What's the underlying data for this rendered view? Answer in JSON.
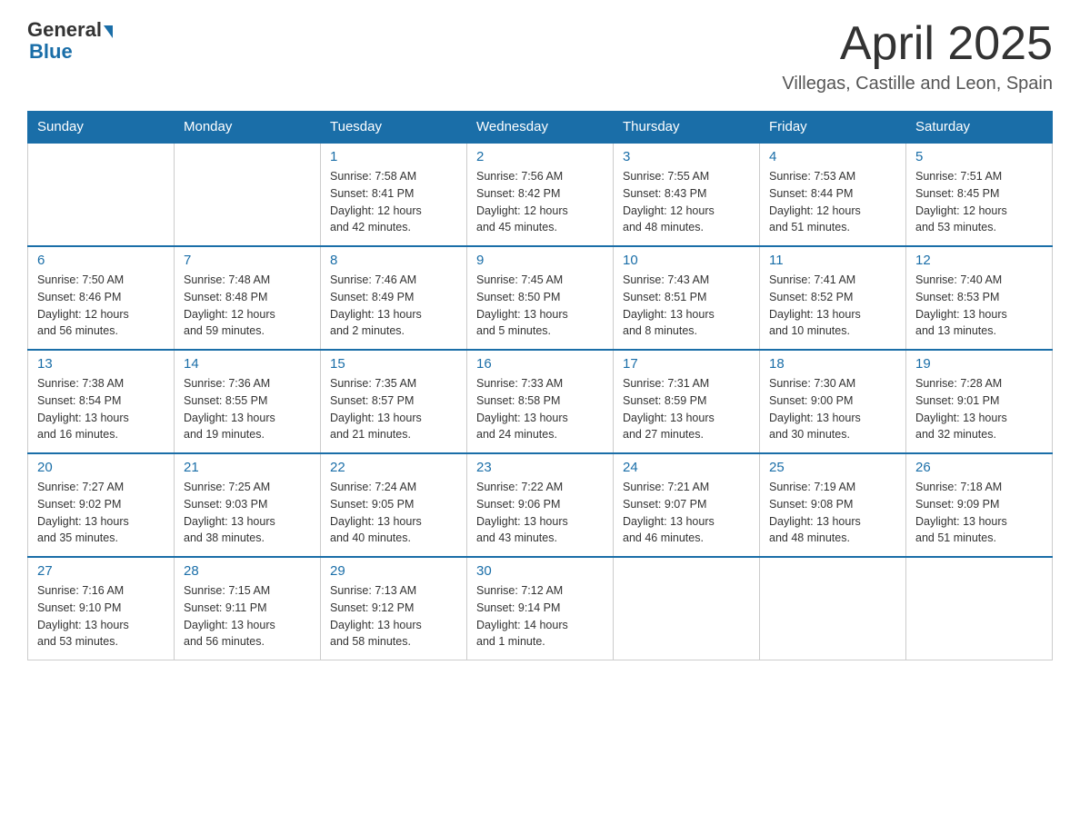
{
  "header": {
    "logo_general": "General",
    "logo_blue": "Blue",
    "month_title": "April 2025",
    "location": "Villegas, Castille and Leon, Spain"
  },
  "weekdays": [
    "Sunday",
    "Monday",
    "Tuesday",
    "Wednesday",
    "Thursday",
    "Friday",
    "Saturday"
  ],
  "weeks": [
    [
      {
        "day": "",
        "info": ""
      },
      {
        "day": "",
        "info": ""
      },
      {
        "day": "1",
        "info": "Sunrise: 7:58 AM\nSunset: 8:41 PM\nDaylight: 12 hours\nand 42 minutes."
      },
      {
        "day": "2",
        "info": "Sunrise: 7:56 AM\nSunset: 8:42 PM\nDaylight: 12 hours\nand 45 minutes."
      },
      {
        "day": "3",
        "info": "Sunrise: 7:55 AM\nSunset: 8:43 PM\nDaylight: 12 hours\nand 48 minutes."
      },
      {
        "day": "4",
        "info": "Sunrise: 7:53 AM\nSunset: 8:44 PM\nDaylight: 12 hours\nand 51 minutes."
      },
      {
        "day": "5",
        "info": "Sunrise: 7:51 AM\nSunset: 8:45 PM\nDaylight: 12 hours\nand 53 minutes."
      }
    ],
    [
      {
        "day": "6",
        "info": "Sunrise: 7:50 AM\nSunset: 8:46 PM\nDaylight: 12 hours\nand 56 minutes."
      },
      {
        "day": "7",
        "info": "Sunrise: 7:48 AM\nSunset: 8:48 PM\nDaylight: 12 hours\nand 59 minutes."
      },
      {
        "day": "8",
        "info": "Sunrise: 7:46 AM\nSunset: 8:49 PM\nDaylight: 13 hours\nand 2 minutes."
      },
      {
        "day": "9",
        "info": "Sunrise: 7:45 AM\nSunset: 8:50 PM\nDaylight: 13 hours\nand 5 minutes."
      },
      {
        "day": "10",
        "info": "Sunrise: 7:43 AM\nSunset: 8:51 PM\nDaylight: 13 hours\nand 8 minutes."
      },
      {
        "day": "11",
        "info": "Sunrise: 7:41 AM\nSunset: 8:52 PM\nDaylight: 13 hours\nand 10 minutes."
      },
      {
        "day": "12",
        "info": "Sunrise: 7:40 AM\nSunset: 8:53 PM\nDaylight: 13 hours\nand 13 minutes."
      }
    ],
    [
      {
        "day": "13",
        "info": "Sunrise: 7:38 AM\nSunset: 8:54 PM\nDaylight: 13 hours\nand 16 minutes."
      },
      {
        "day": "14",
        "info": "Sunrise: 7:36 AM\nSunset: 8:55 PM\nDaylight: 13 hours\nand 19 minutes."
      },
      {
        "day": "15",
        "info": "Sunrise: 7:35 AM\nSunset: 8:57 PM\nDaylight: 13 hours\nand 21 minutes."
      },
      {
        "day": "16",
        "info": "Sunrise: 7:33 AM\nSunset: 8:58 PM\nDaylight: 13 hours\nand 24 minutes."
      },
      {
        "day": "17",
        "info": "Sunrise: 7:31 AM\nSunset: 8:59 PM\nDaylight: 13 hours\nand 27 minutes."
      },
      {
        "day": "18",
        "info": "Sunrise: 7:30 AM\nSunset: 9:00 PM\nDaylight: 13 hours\nand 30 minutes."
      },
      {
        "day": "19",
        "info": "Sunrise: 7:28 AM\nSunset: 9:01 PM\nDaylight: 13 hours\nand 32 minutes."
      }
    ],
    [
      {
        "day": "20",
        "info": "Sunrise: 7:27 AM\nSunset: 9:02 PM\nDaylight: 13 hours\nand 35 minutes."
      },
      {
        "day": "21",
        "info": "Sunrise: 7:25 AM\nSunset: 9:03 PM\nDaylight: 13 hours\nand 38 minutes."
      },
      {
        "day": "22",
        "info": "Sunrise: 7:24 AM\nSunset: 9:05 PM\nDaylight: 13 hours\nand 40 minutes."
      },
      {
        "day": "23",
        "info": "Sunrise: 7:22 AM\nSunset: 9:06 PM\nDaylight: 13 hours\nand 43 minutes."
      },
      {
        "day": "24",
        "info": "Sunrise: 7:21 AM\nSunset: 9:07 PM\nDaylight: 13 hours\nand 46 minutes."
      },
      {
        "day": "25",
        "info": "Sunrise: 7:19 AM\nSunset: 9:08 PM\nDaylight: 13 hours\nand 48 minutes."
      },
      {
        "day": "26",
        "info": "Sunrise: 7:18 AM\nSunset: 9:09 PM\nDaylight: 13 hours\nand 51 minutes."
      }
    ],
    [
      {
        "day": "27",
        "info": "Sunrise: 7:16 AM\nSunset: 9:10 PM\nDaylight: 13 hours\nand 53 minutes."
      },
      {
        "day": "28",
        "info": "Sunrise: 7:15 AM\nSunset: 9:11 PM\nDaylight: 13 hours\nand 56 minutes."
      },
      {
        "day": "29",
        "info": "Sunrise: 7:13 AM\nSunset: 9:12 PM\nDaylight: 13 hours\nand 58 minutes."
      },
      {
        "day": "30",
        "info": "Sunrise: 7:12 AM\nSunset: 9:14 PM\nDaylight: 14 hours\nand 1 minute."
      },
      {
        "day": "",
        "info": ""
      },
      {
        "day": "",
        "info": ""
      },
      {
        "day": "",
        "info": ""
      }
    ]
  ]
}
